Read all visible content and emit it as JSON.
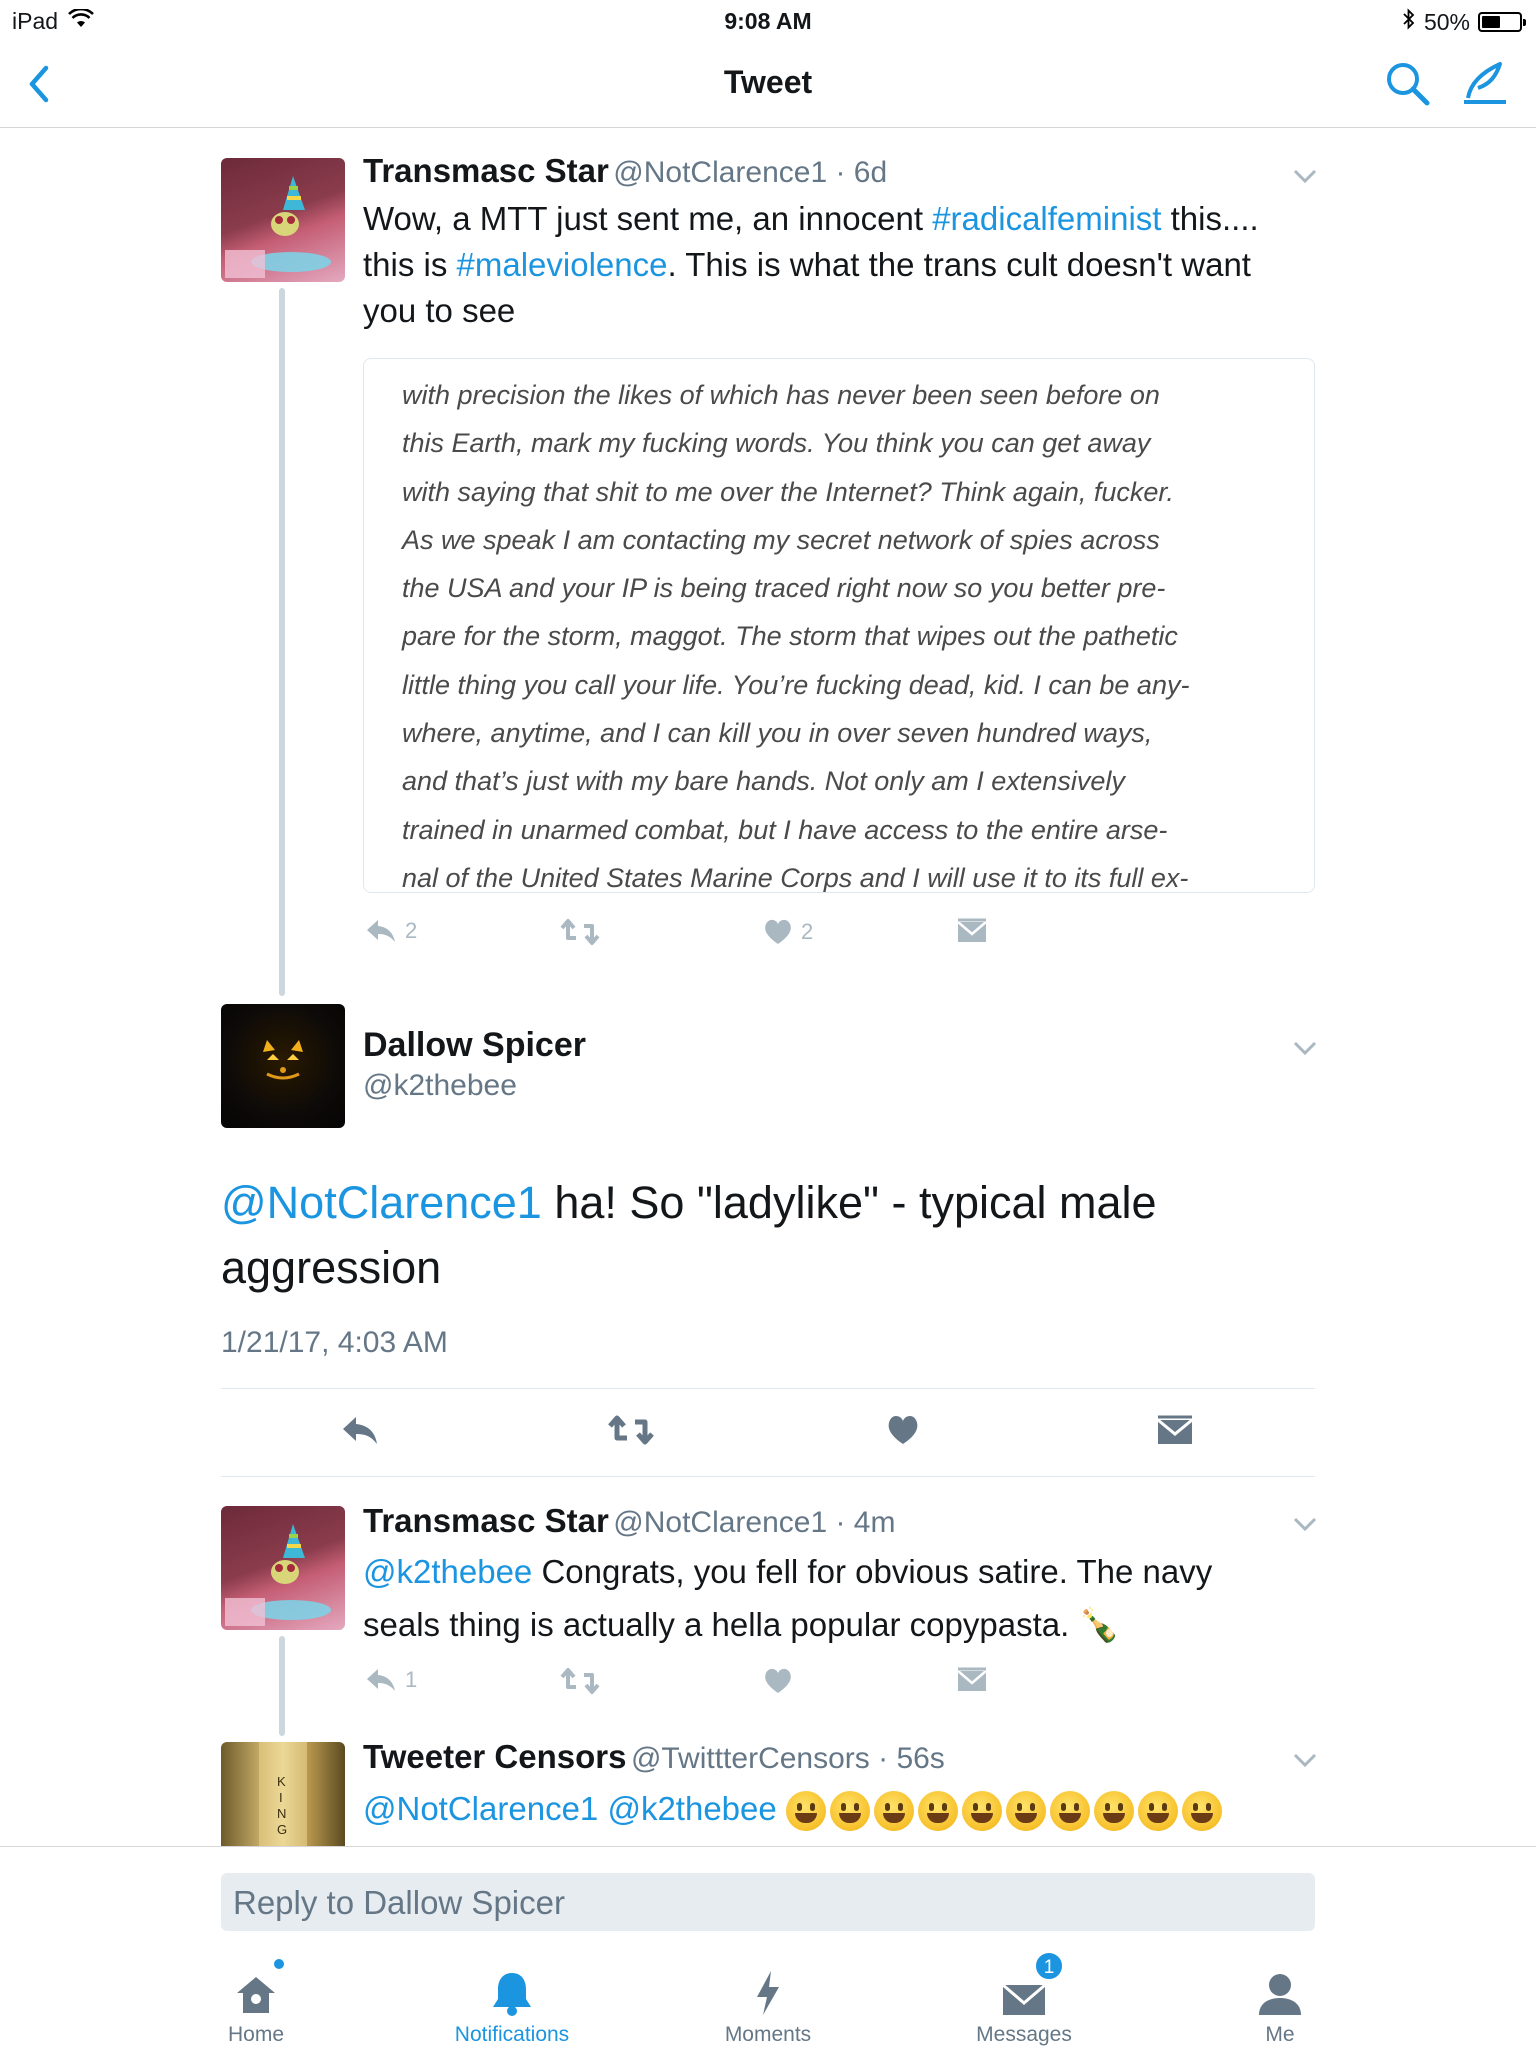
{
  "status_bar": {
    "device": "iPad",
    "time": "9:08 AM",
    "battery": "50%",
    "battery_level": 0.5
  },
  "nav": {
    "title": "Tweet"
  },
  "tweets": [
    {
      "name": "Transmasc Star",
      "handle": "@NotClarence1 · 6d",
      "text_parts": [
        "Wow, a MTT just sent me, an innocent ",
        "#radicalfeminist",
        " this.... this is ",
        "#maleviolence",
        ". This is what the trans cult doesn't want you to see"
      ],
      "quote_lines": [
        "with precision the likes of which has never been seen before on",
        "this Earth, mark my fucking words. You think you can get away",
        "with saying that shit to me over the Internet? Think again, fucker.",
        "As we speak I am contacting my secret network of spies across",
        "the USA and your IP is being traced right now so you better pre-",
        "pare for the storm, maggot. The storm that wipes out the pathetic",
        "little thing you call your life. You’re fucking dead, kid. I can be any-",
        "where, anytime, and I can kill you in over seven hundred ways,",
        "and that’s just with my bare hands. Not only am I extensively",
        "trained in unarmed combat, but I have access to the entire arse-",
        "nal of the United States Marine Corps and I will use it to its full ex-"
      ],
      "reply_count": "2",
      "like_count": "2"
    },
    {
      "name": "Transmasc Star",
      "handle": "@NotClarence1 · 4m",
      "text_parts": [
        "@k2thebee",
        " Congrats, you fell for obvious satire. The navy seals thing is actually a hella popular copypasta. ",
        "🍾"
      ],
      "reply_count": "1"
    },
    {
      "name": "Tweeter Censors",
      "handle": "@TwittterCensors · 56s",
      "mentions": "@NotClarence1 @k2thebee"
    }
  ],
  "focus": {
    "name": "Dallow Spicer",
    "handle": "@k2thebee",
    "mention": "@NotClarence1",
    "text": " ha! So \"ladylike\" - typical male aggression",
    "date": "1/21/17, 4:03 AM"
  },
  "reply": {
    "placeholder": "Reply to Dallow Spicer"
  },
  "tabs": [
    {
      "label": "Home"
    },
    {
      "label": "Notifications"
    },
    {
      "label": "Moments"
    },
    {
      "label": "Messages",
      "badge": "1"
    },
    {
      "label": "Me"
    }
  ],
  "colors": {
    "link": "#1b95e0",
    "text": "#14171a",
    "secondary": "#657786",
    "icon": "#aab8c2"
  }
}
